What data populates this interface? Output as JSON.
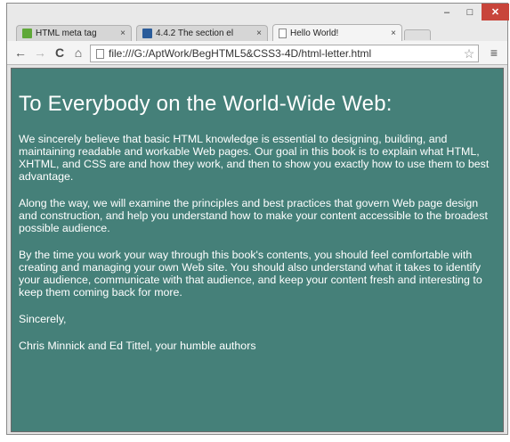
{
  "tabs": [
    {
      "label": "HTML meta tag",
      "icon": "w3schools-favicon-icon",
      "close": "×"
    },
    {
      "label": "4.4.2 The section el",
      "icon": "w3c-favicon-icon",
      "close": "×"
    },
    {
      "label": "Hello World!",
      "icon": "page-icon",
      "close": "×"
    }
  ],
  "window_controls": {
    "minimize": "–",
    "maximize": "□",
    "close": "✕"
  },
  "toolbar": {
    "back": "←",
    "forward": "→",
    "reload": "C",
    "home": "⌂",
    "star": "☆",
    "menu": "≡"
  },
  "address_bar": {
    "url": "file:///G:/AptWork/BegHTML5&CSS3-4D/html-letter.html"
  },
  "page": {
    "heading": "To Everybody on the World-Wide Web:",
    "paragraphs": [
      "We sincerely believe that basic HTML knowledge is essential to designing, building, and maintaining readable and workable Web pages. Our goal in this book is to explain what HTML, XHTML, and CSS are and how they work, and then to show you exactly how to use them to best advantage.",
      "Along the way, we will examine the principles and best practices that govern Web page design and construction, and help you understand how to make your content accessible to the broadest possible audience.",
      "By the time you work your way through this book's contents, you should feel comfortable with creating and managing your own Web site. You should also understand what it takes to identify your audience, communicate with that audience, and keep your content fresh and interesting to keep them coming back for more.",
      "Sincerely,",
      "Chris Minnick and Ed Tittel, your humble authors"
    ]
  },
  "colors": {
    "page_background": "#458079",
    "page_text": "#ffffff",
    "close_button": "#c8453b"
  }
}
